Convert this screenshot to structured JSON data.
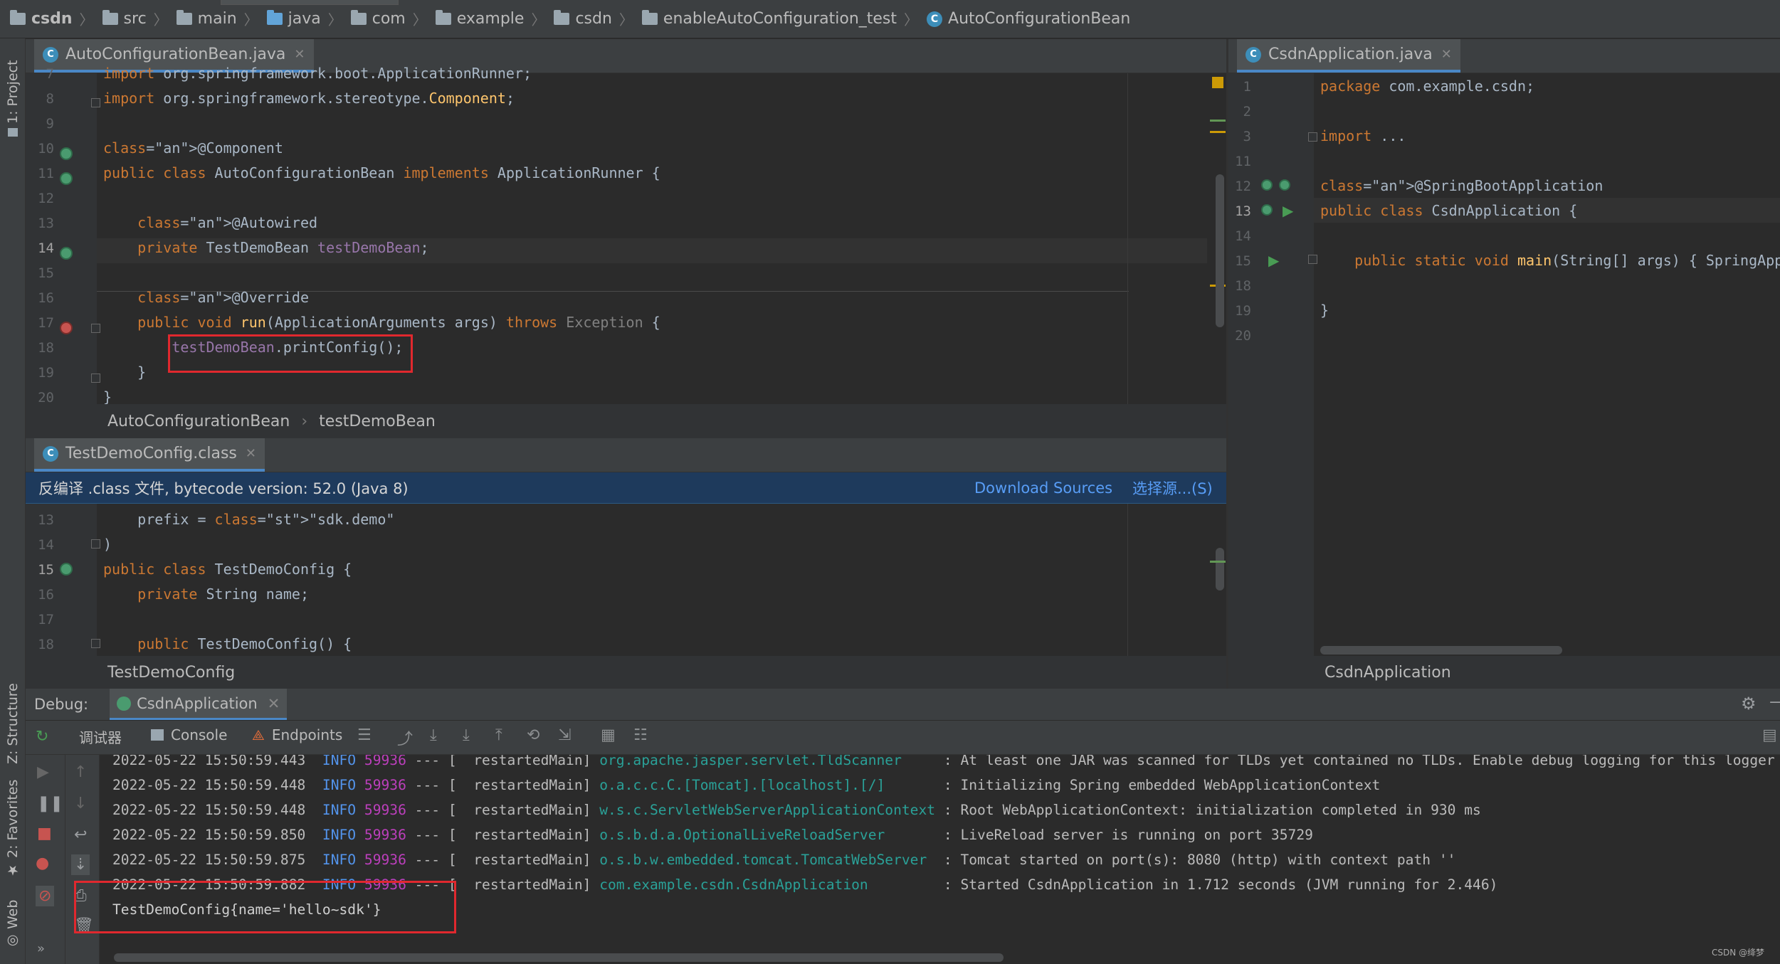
{
  "breadcrumb": [
    "csdn",
    "src",
    "main",
    "java",
    "com",
    "example",
    "csdn",
    "enableAutoConfiguration_test",
    "AutoConfigurationBean"
  ],
  "left_strip": {
    "project": "1: Project",
    "structure": "Z: Structure",
    "favorites": "2: Favorites",
    "web": "Web"
  },
  "editor_left": {
    "tab": "AutoConfigurationBean.java",
    "lines": [
      {
        "n": "7",
        "code": "import org.springframework.boot.ApplicationRunner;"
      },
      {
        "n": "8",
        "code": "import org.springframework.stereotype.Component;"
      },
      {
        "n": "9",
        "code": ""
      },
      {
        "n": "10",
        "code": "@Component"
      },
      {
        "n": "11",
        "code": "public class AutoConfigurationBean implements ApplicationRunner {"
      },
      {
        "n": "12",
        "code": ""
      },
      {
        "n": "13",
        "code": "    @Autowired"
      },
      {
        "n": "14",
        "code": "    private TestDemoBean testDemoBean;"
      },
      {
        "n": "15",
        "code": ""
      },
      {
        "n": "16",
        "code": "    @Override"
      },
      {
        "n": "17",
        "code": "    public void run(ApplicationArguments args) throws Exception {"
      },
      {
        "n": "18",
        "code": "        testDemoBean.printConfig();"
      },
      {
        "n": "19",
        "code": "    }"
      },
      {
        "n": "20",
        "code": "}"
      }
    ],
    "crumb1": "AutoConfigurationBean",
    "crumb2": "testDemoBean"
  },
  "editor_class": {
    "tab": "TestDemoConfig.class",
    "banner": "反编译 .class 文件, bytecode version: 52.0 (Java 8)",
    "download": "Download Sources",
    "choose": "选择源...(S)",
    "lines": [
      {
        "n": "13",
        "code": "    prefix = \"sdk.demo\""
      },
      {
        "n": "14",
        "code": ")"
      },
      {
        "n": "15",
        "code": "public class TestDemoConfig {"
      },
      {
        "n": "16",
        "code": "    private String name;"
      },
      {
        "n": "17",
        "code": ""
      },
      {
        "n": "18",
        "code": "    public TestDemoConfig() {"
      }
    ],
    "crumb": "TestDemoConfig"
  },
  "editor_right": {
    "tab": "CsdnApplication.java",
    "lines": [
      {
        "n": "1",
        "code": "package com.example.csdn;"
      },
      {
        "n": "2",
        "code": ""
      },
      {
        "n": "3",
        "code": "import ..."
      },
      {
        "n": "11",
        "code": ""
      },
      {
        "n": "12",
        "code": "@SpringBootApplication"
      },
      {
        "n": "13",
        "code": "public class CsdnApplication {"
      },
      {
        "n": "14",
        "code": ""
      },
      {
        "n": "15",
        "code": "    public static void main(String[] args) { SpringApp"
      },
      {
        "n": "18",
        "code": ""
      },
      {
        "n": "19",
        "code": "}"
      },
      {
        "n": "20",
        "code": ""
      }
    ],
    "crumb": "CsdnApplication"
  },
  "debug": {
    "label": "Debug:",
    "session": "CsdnApplication",
    "tabs": [
      "调试器",
      "Console",
      "Endpoints"
    ],
    "log": [
      {
        "ts": "2022-05-22 15:50:59.443",
        "lvl": "INFO",
        "pid": "59936",
        "sep": "---",
        "thread": "[  restartedMain]",
        "logger": "org.apache.jasper.servlet.TldScanner",
        "msg": ": At least one JAR was scanned for TLDs yet contained no TLDs. Enable debug logging for this logger"
      },
      {
        "ts": "2022-05-22 15:50:59.448",
        "lvl": "INFO",
        "pid": "59936",
        "sep": "---",
        "thread": "[  restartedMain]",
        "logger": "o.a.c.c.C.[Tomcat].[localhost].[/]",
        "msg": ": Initializing Spring embedded WebApplicationContext"
      },
      {
        "ts": "2022-05-22 15:50:59.448",
        "lvl": "INFO",
        "pid": "59936",
        "sep": "---",
        "thread": "[  restartedMain]",
        "logger": "w.s.c.ServletWebServerApplicationContext",
        "msg": ": Root WebApplicationContext: initialization completed in 930 ms"
      },
      {
        "ts": "2022-05-22 15:50:59.850",
        "lvl": "INFO",
        "pid": "59936",
        "sep": "---",
        "thread": "[  restartedMain]",
        "logger": "o.s.b.d.a.OptionalLiveReloadServer",
        "msg": ": LiveReload server is running on port 35729"
      },
      {
        "ts": "2022-05-22 15:50:59.875",
        "lvl": "INFO",
        "pid": "59936",
        "sep": "---",
        "thread": "[  restartedMain]",
        "logger": "o.s.b.w.embedded.tomcat.TomcatWebServer",
        "msg": ": Tomcat started on port(s): 8080 (http) with context path ''"
      },
      {
        "ts": "2022-05-22 15:50:59.882",
        "lvl": "INFO",
        "pid": "59936",
        "sep": "---",
        "thread": "[  restartedMain]",
        "logger": "com.example.csdn.CsdnApplication",
        "msg": ": Started CsdnApplication in 1.712 seconds (JVM running for 2.446)"
      }
    ],
    "output": "TestDemoConfig{name='hello~sdk'}"
  },
  "watermark": "CSDN @绛梦",
  "colors": {
    "background": "#2b2b2b",
    "panel": "#3c3f41",
    "gutter": "#313335",
    "highlight_box": "#e0282e",
    "keyword": "#cc7832",
    "annotation": "#bbb529",
    "field": "#9876aa",
    "string": "#6a8759"
  }
}
